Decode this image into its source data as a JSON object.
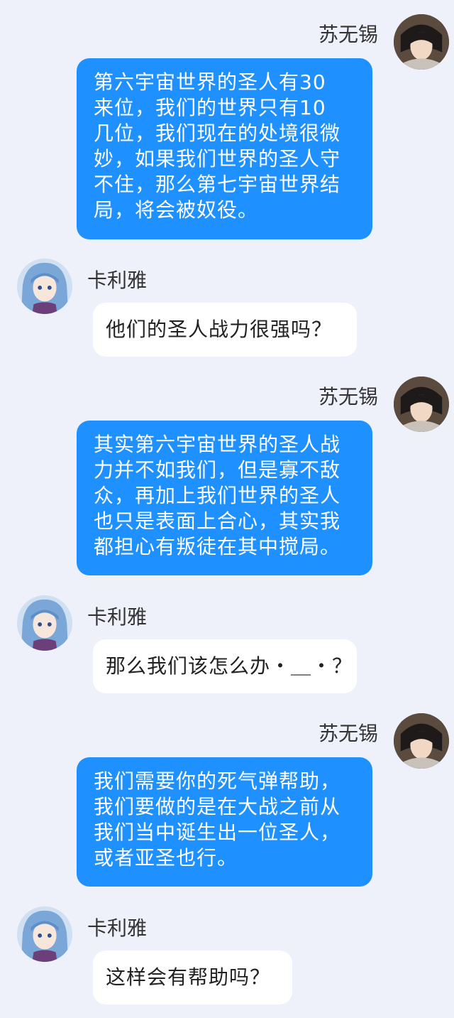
{
  "contacts": {
    "self": {
      "name": "苏无锡",
      "avatar_icon": "anime-dark-hair-avatar-icon"
    },
    "other": {
      "name": "卡利雅",
      "avatar_icon": "anime-blue-hair-avatar-icon"
    }
  },
  "colors": {
    "background": "#eef1f9",
    "outgoing_bubble": "#1e90ff",
    "incoming_bubble": "#ffffff"
  },
  "messages": [
    {
      "sender": "苏无锡",
      "lines": [
        "第六宇宙世界的圣人有30",
        "来位，我们的世界只有10",
        "几位，我们现在的处境很微",
        "妙，如果我们世界的圣人守",
        "不住，那么第七宇宙世界结",
        "局，将会被奴役。"
      ]
    },
    {
      "sender": "卡利雅",
      "lines": [
        "他们的圣人战力很强吗？"
      ]
    },
    {
      "sender": "苏无锡",
      "lines": [
        "其实第六宇宙世界的圣人战",
        "力并不如我们，但是寡不敌",
        "众，再加上我们世界的圣人",
        "也只是表面上合心，其实我",
        "都担心有叛徒在其中搅局。"
      ]
    },
    {
      "sender": "卡利雅",
      "lines": [
        "那么我们该怎么办・＿・？"
      ]
    },
    {
      "sender": "苏无锡",
      "lines": [
        "我们需要你的死气弹帮助，",
        "我们要做的是在大战之前从",
        "我们当中诞生出一位圣人，",
        "或者亚圣也行。"
      ]
    },
    {
      "sender": "卡利雅",
      "lines": [
        "这样会有帮助吗？"
      ]
    }
  ]
}
